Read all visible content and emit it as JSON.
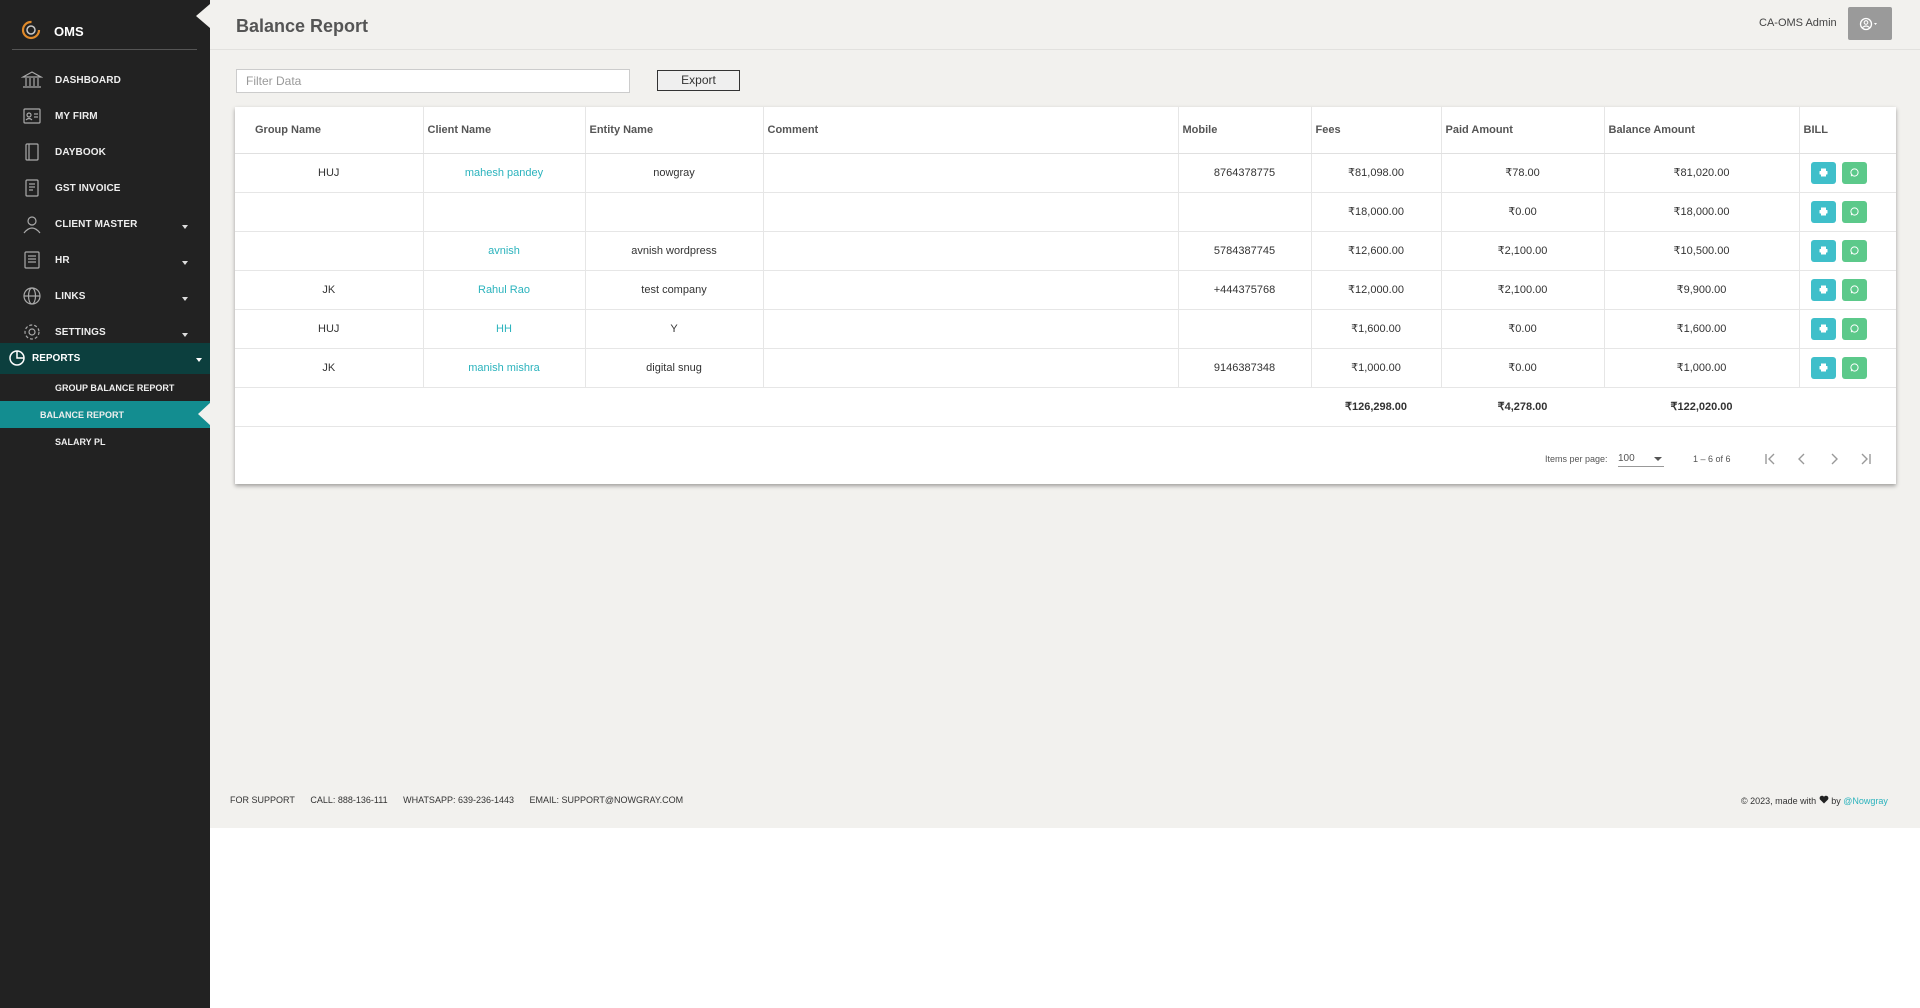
{
  "app": {
    "name": "OMS"
  },
  "sidebar": {
    "items": [
      {
        "label": "DASHBOARD",
        "icon": "bank-icon"
      },
      {
        "label": "MY FIRM",
        "icon": "firm-icon"
      },
      {
        "label": "DAYBOOK",
        "icon": "book-icon"
      },
      {
        "label": "GST INVOICE",
        "icon": "invoice-icon"
      },
      {
        "label": "CLIENT MASTER",
        "icon": "user-icon"
      },
      {
        "label": "HR",
        "icon": "document-icon"
      },
      {
        "label": "LINKS",
        "icon": "globe-icon"
      },
      {
        "label": "SETTINGS",
        "icon": "gear-icon"
      }
    ],
    "reports": {
      "label": "REPORTS",
      "icon": "pie-chart-icon",
      "sub_items": [
        {
          "label": "GROUP BALANCE REPORT"
        },
        {
          "label": "BALANCE REPORT"
        },
        {
          "label": "SALARY PL"
        }
      ]
    }
  },
  "header": {
    "title": "Balance Report",
    "user_name": "CA-OMS Admin"
  },
  "toolbar": {
    "filter_placeholder": "Filter Data",
    "export_label": "Export"
  },
  "table": {
    "columns": [
      "Group Name",
      "Client Name",
      "Entity Name",
      "Comment",
      "Mobile",
      "Fees",
      "Paid Amount",
      "Balance Amount",
      "BILL"
    ],
    "rows": [
      {
        "group": "HUJ",
        "client": "mahesh pandey",
        "entity": "nowgray",
        "comment": "",
        "mobile": "8764378775",
        "fees": "₹81,098.00",
        "paid": "₹78.00",
        "balance": "₹81,020.00"
      },
      {
        "group": "",
        "client": "",
        "entity": "",
        "comment": "",
        "mobile": "",
        "fees": "₹18,000.00",
        "paid": "₹0.00",
        "balance": "₹18,000.00"
      },
      {
        "group": "",
        "client": "avnish",
        "entity": "avnish wordpress",
        "comment": "",
        "mobile": "5784387745",
        "fees": "₹12,600.00",
        "paid": "₹2,100.00",
        "balance": "₹10,500.00"
      },
      {
        "group": "JK",
        "client": "Rahul Rao",
        "entity": "test company",
        "comment": "",
        "mobile": "+444375768",
        "fees": "₹12,000.00",
        "paid": "₹2,100.00",
        "balance": "₹9,900.00"
      },
      {
        "group": "HUJ",
        "client": "HH",
        "entity": "Y",
        "comment": "",
        "mobile": "",
        "fees": "₹1,600.00",
        "paid": "₹0.00",
        "balance": "₹1,600.00"
      },
      {
        "group": "JK",
        "client": "manish mishra",
        "entity": "digital snug",
        "comment": "",
        "mobile": "9146387348",
        "fees": "₹1,000.00",
        "paid": "₹0.00",
        "balance": "₹1,000.00"
      }
    ],
    "totals": {
      "fees": "₹126,298.00",
      "paid": "₹4,278.00",
      "balance": "₹122,020.00"
    }
  },
  "paginator": {
    "items_per_page_label": "Items per page:",
    "page_size": "100",
    "range": "1 – 6 of 6"
  },
  "footer": {
    "support": "FOR SUPPORT",
    "call": "CALL: 888-136-111",
    "whatsapp": "WHATSAPP: 639-236-1443",
    "email": "EMAIL: SUPPORT@NOWGRAY.COM",
    "copyright_prefix": "© 2023, made with",
    "by": "by",
    "brand": "@Nowgray"
  },
  "colors": {
    "sidebar_bg": "#222222",
    "reports_bg": "#0c3f3e",
    "active_sub_bg": "#138d90",
    "main_bg": "#f2f1ee",
    "link": "#2bb3bd",
    "print_btn": "#3fbfca",
    "whatsapp_btn": "#5cc98a"
  }
}
